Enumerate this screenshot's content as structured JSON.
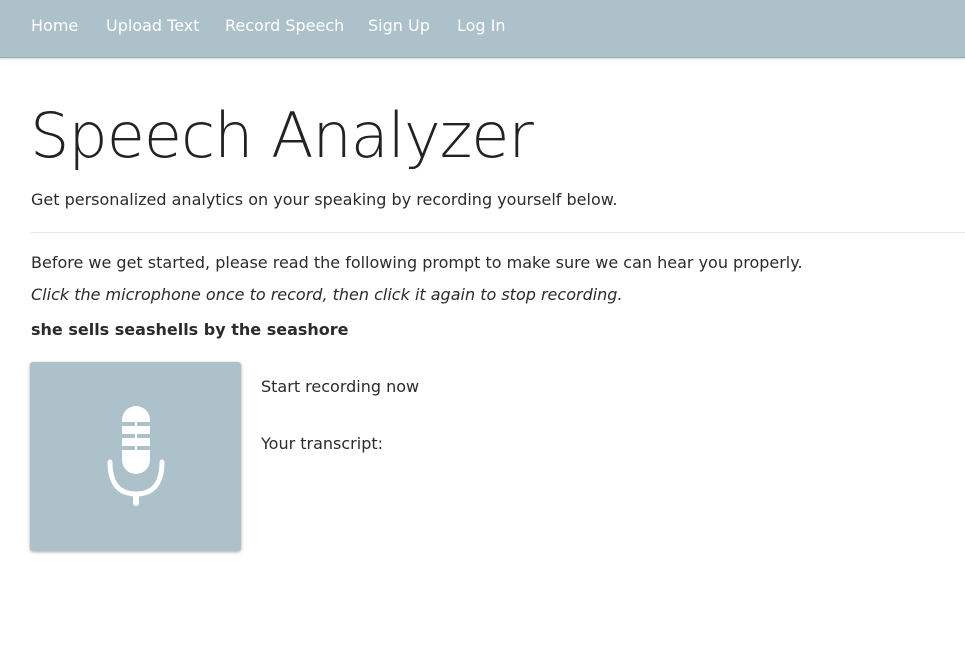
{
  "nav": {
    "items": [
      {
        "label": "Home"
      },
      {
        "label": "Upload Text"
      },
      {
        "label": "Record Speech"
      },
      {
        "label": "Sign Up"
      },
      {
        "label": "Log In"
      }
    ]
  },
  "header": {
    "title": "Speech Analyzer",
    "subtitle": "Get personalized analytics on your speaking by recording yourself below."
  },
  "main": {
    "intro": "Before we get started, please read the following prompt to make sure we can hear you properly.",
    "instruction": "Click the microphone once to record, then click it again to stop recording.",
    "prompt": "she sells seashells by the seashore",
    "status": "Start recording now",
    "transcript_label": "Your transcript:",
    "mic_icon": "microphone-icon"
  },
  "colors": {
    "navbar": "#adc1ca",
    "mic_button": "#adc1ca",
    "nav_text": "#ffffff"
  }
}
